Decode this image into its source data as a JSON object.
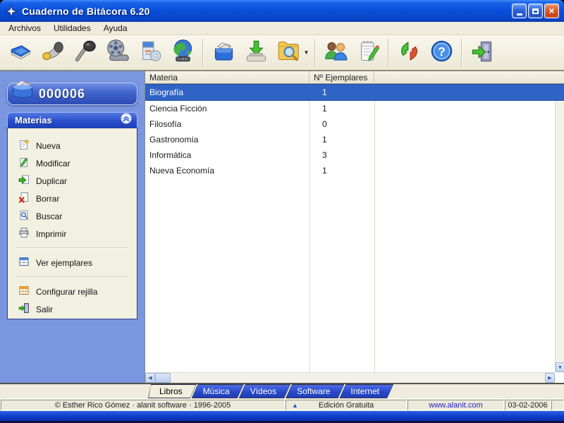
{
  "window": {
    "title": "Cuaderno de Bitácora 6.20"
  },
  "menu_bar": [
    "Archivos",
    "Utilidades",
    "Ayuda"
  ],
  "toolbar": {
    "groups": [
      [
        {
          "icon": "book"
        },
        {
          "icon": "speaker"
        },
        {
          "icon": "microphone"
        },
        {
          "icon": "film-reel"
        },
        {
          "icon": "software-box"
        },
        {
          "icon": "globe"
        }
      ],
      [
        {
          "icon": "card-box"
        },
        {
          "icon": "import"
        },
        {
          "icon": "search-folder",
          "has_dropdown": true
        }
      ],
      [
        {
          "icon": "users"
        },
        {
          "icon": "notepad"
        }
      ],
      [
        {
          "icon": "refresh"
        },
        {
          "icon": "help"
        }
      ],
      [
        {
          "icon": "exit-door"
        }
      ]
    ]
  },
  "sidebar": {
    "record_number": "000006",
    "panel_title": "Materias",
    "collapse_icon": "chevron-up-circle",
    "groups": [
      [
        {
          "icon": "new-page",
          "label": "Nueva"
        },
        {
          "icon": "edit",
          "label": "Modificar"
        },
        {
          "icon": "duplicate",
          "label": "Duplicar"
        },
        {
          "icon": "delete",
          "label": "Borrar"
        },
        {
          "icon": "search",
          "label": "Buscar"
        },
        {
          "icon": "print",
          "label": "Imprimir"
        }
      ],
      [
        {
          "icon": "grid-view",
          "label": "Ver ejemplares"
        }
      ],
      [
        {
          "icon": "configure-grid",
          "label": "Configurar rejilla"
        },
        {
          "icon": "exit",
          "label": "Salir"
        }
      ]
    ]
  },
  "table": {
    "columns": [
      "Materia",
      "Nº Ejemplares"
    ],
    "rows": [
      {
        "materia": "Biografía",
        "ejemplares": "1"
      },
      {
        "materia": "Ciencia Ficción",
        "ejemplares": "1"
      },
      {
        "materia": "Filosofía",
        "ejemplares": "0"
      },
      {
        "materia": "Gastronomía",
        "ejemplares": "1"
      },
      {
        "materia": "Informática",
        "ejemplares": "3"
      },
      {
        "materia": "Nueva Economía",
        "ejemplares": "1"
      }
    ],
    "selected_index": 0
  },
  "tabs": {
    "active": "Libros",
    "items": [
      "Libros",
      "Música",
      "Vídeos",
      "Software",
      "Internet"
    ]
  },
  "status_bar": {
    "copyright": "© Esther Rico Gómez · alanit software · 1996-2005",
    "edition": "Edición Gratuita",
    "website": "www.alanit.com",
    "date": "03-02-2006"
  },
  "colors": {
    "selection_blue": "#2f63c5",
    "sidebar_blue": "#7b96e1",
    "tab_blue": "#2747c4",
    "titlebar_blue": "#0a50dc",
    "link_blue": "#2222cc",
    "toolbar_beige": "#f1eee0"
  }
}
